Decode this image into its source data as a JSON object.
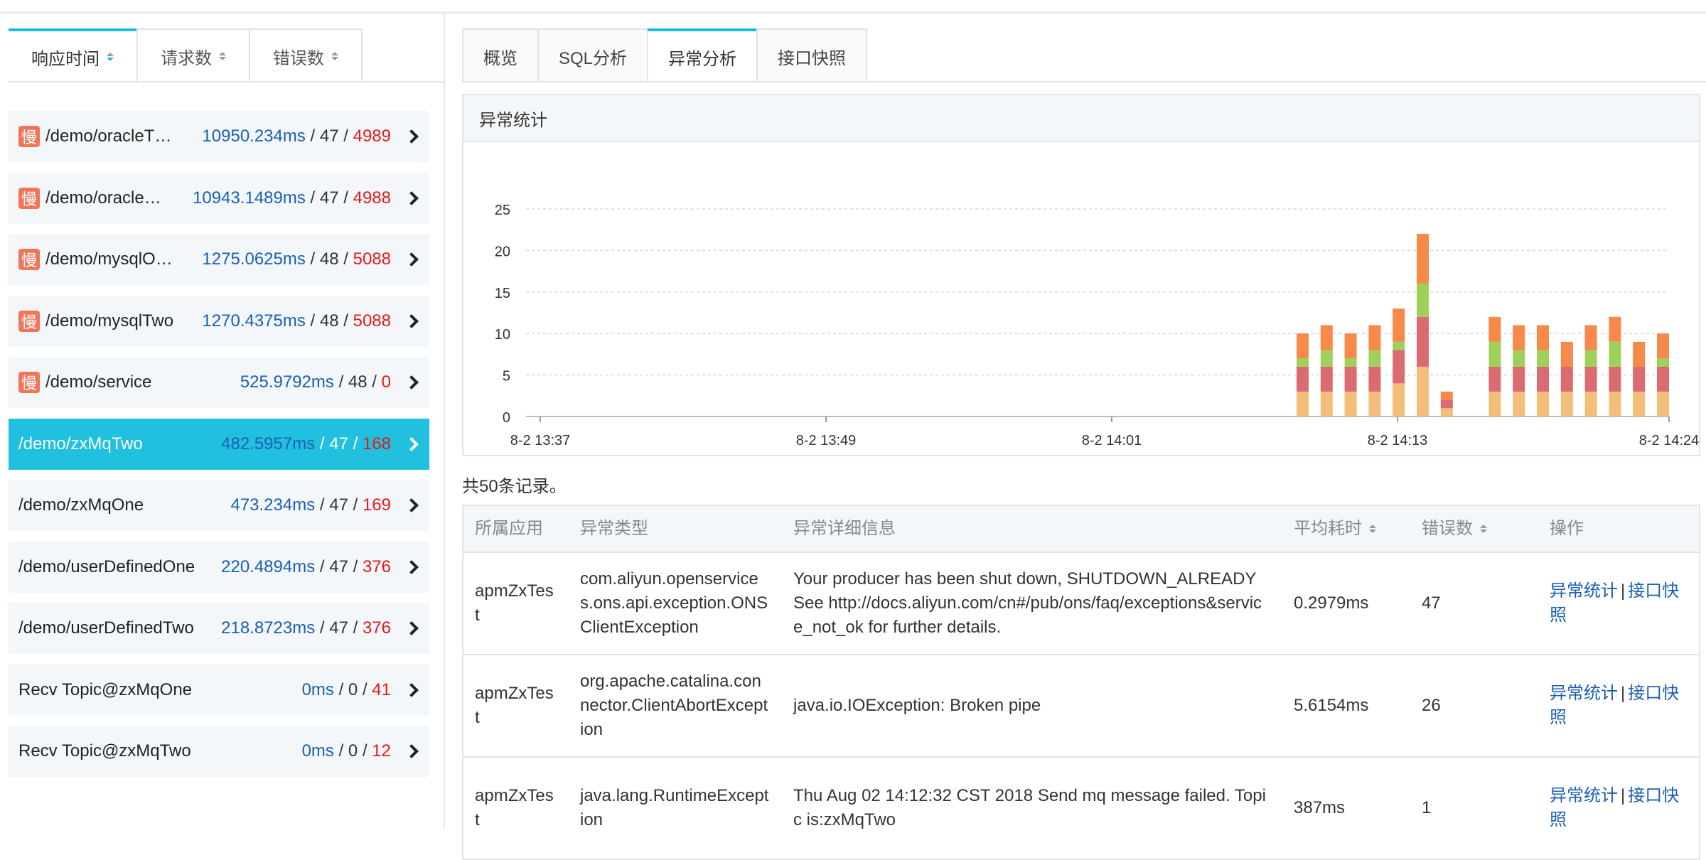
{
  "left_tabs": [
    {
      "label": "响应时间",
      "width": 182,
      "active": true
    },
    {
      "label": "请求数",
      "width": 160,
      "active": false
    },
    {
      "label": "错误数",
      "width": 160,
      "active": false
    }
  ],
  "interfaces": [
    {
      "slow": true,
      "name": "/demo/oracleT…",
      "rt": "10950.234ms",
      "count": "47",
      "errors": "4989"
    },
    {
      "slow": true,
      "name": "/demo/oracle…",
      "rt": "10943.1489ms",
      "count": "47",
      "errors": "4988"
    },
    {
      "slow": true,
      "name": "/demo/mysqlO…",
      "rt": "1275.0625ms",
      "count": "48",
      "errors": "5088"
    },
    {
      "slow": true,
      "name": "/demo/mysqlTwo",
      "rt": "1270.4375ms",
      "count": "48",
      "errors": "5088"
    },
    {
      "slow": true,
      "name": "/demo/service",
      "rt": "525.9792ms",
      "count": "48",
      "errors": "0"
    },
    {
      "slow": false,
      "active": true,
      "name": "/demo/zxMqTwo",
      "rt": "482.5957ms",
      "count": "47",
      "errors": "168"
    },
    {
      "slow": false,
      "name": "/demo/zxMqOne",
      "rt": "473.234ms",
      "count": "47",
      "errors": "169"
    },
    {
      "slow": false,
      "name": "/demo/userDefinedOne",
      "rt": "220.4894ms",
      "count": "47",
      "errors": "376"
    },
    {
      "slow": false,
      "name": "/demo/userDefinedTwo",
      "rt": "218.8723ms",
      "count": "47",
      "errors": "376"
    },
    {
      "slow": false,
      "name": "Recv Topic@zxMqOne",
      "rt": "0ms",
      "count": "0",
      "errors": "41"
    },
    {
      "slow": false,
      "name": "Recv Topic@zxMqTwo",
      "rt": "0ms",
      "count": "0",
      "errors": "12"
    }
  ],
  "slow_label": "慢",
  "right_tabs": [
    {
      "label": "概览",
      "width": 108,
      "active": false
    },
    {
      "label": "SQL分析",
      "width": 156,
      "active": false
    },
    {
      "label": "异常分析",
      "width": 156,
      "active": true
    },
    {
      "label": "接口快照",
      "width": 156,
      "active": false
    }
  ],
  "chart_title": "异常统计",
  "chart_data": {
    "type": "bar",
    "stacked": true,
    "categories": [
      "14:08",
      "14:09",
      "14:10",
      "14:11",
      "14:12",
      "14:13",
      "14:14",
      "14:15",
      "14:16",
      "14:17",
      "14:18",
      "14:19",
      "14:20",
      "14:21",
      "14:22",
      "14:23"
    ],
    "series": [
      {
        "color": "#f3bd7a",
        "values": [
          3,
          3,
          3,
          3,
          4,
          6,
          1,
          0,
          3,
          3,
          3,
          3,
          3,
          3,
          3,
          3
        ]
      },
      {
        "color": "#db6b72",
        "values": [
          3,
          3,
          3,
          3,
          4,
          6,
          1,
          0,
          3,
          3,
          3,
          3,
          3,
          3,
          3,
          3
        ]
      },
      {
        "color": "#9fd15a",
        "values": [
          1,
          2,
          1,
          2,
          1,
          4,
          0,
          0,
          3,
          2,
          2,
          0,
          2,
          3,
          0,
          1
        ]
      },
      {
        "color": "#f7894a",
        "values": [
          3,
          3,
          3,
          3,
          4,
          6,
          1,
          0,
          3,
          3,
          3,
          3,
          3,
          3,
          3,
          3
        ]
      }
    ],
    "ylim": [
      0,
      25
    ],
    "yticks": [
      0,
      5,
      10,
      15,
      20,
      25
    ],
    "xtick_labels": [
      "8-2 13:37",
      "8-2 13:49",
      "8-2 14:01",
      "8-2 14:13",
      "8-2 14:24"
    ],
    "grid": true
  },
  "total_text": "共50条记录。",
  "table_headers": [
    "所属应用",
    "异常类型",
    "异常详细信息",
    "平均耗时",
    "错误数",
    "操作"
  ],
  "table_rows": [
    {
      "app": "apmZxTest",
      "type": "com.aliyun.openservices.ons.api.exception.ONSClientException",
      "detail": "Your producer has been shut down, SHUTDOWN_ALREADY See http://docs.aliyun.com/cn#/pub/ons/faq/exceptions&service_not_ok for further details.",
      "avg": "0.2979ms",
      "errors": "47"
    },
    {
      "app": "apmZxTest",
      "type": "org.apache.catalina.connector.ClientAbortException",
      "detail": "java.io.IOException: Broken pipe",
      "avg": "5.6154ms",
      "errors": "26"
    },
    {
      "app": "apmZxTest",
      "type": "java.lang.RuntimeException",
      "detail": "Thu Aug 02 14:12:32 CST 2018 Send mq message failed. Topic is:zxMqTwo",
      "avg": "387ms",
      "errors": "1"
    }
  ],
  "action_labels": [
    "异常统计",
    "|",
    "接口快照"
  ]
}
